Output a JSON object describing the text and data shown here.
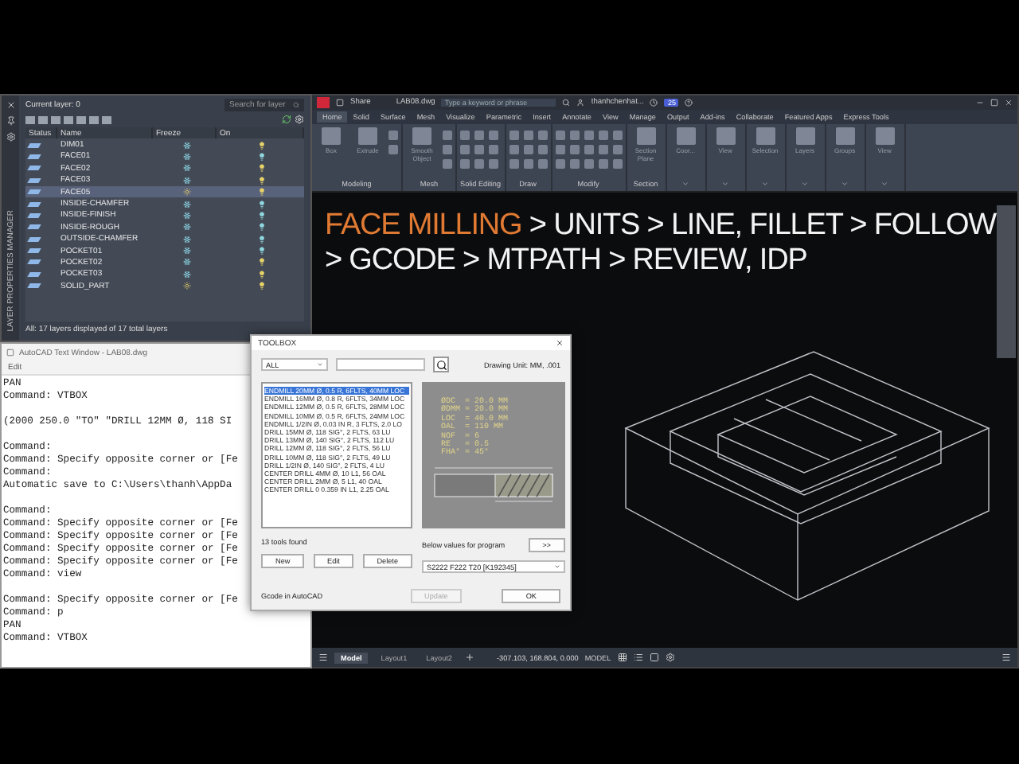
{
  "layer_manager": {
    "side_title": "LAYER PROPERTIES MANAGER",
    "current_layer": "Current layer: 0",
    "search": {
      "placeholder": "Search for layer"
    },
    "columns": [
      "Status",
      "Name",
      "Freeze",
      "On"
    ],
    "rows": [
      {
        "name": "DIM01",
        "frozen": true,
        "color": "#e8d36a",
        "selected": false
      },
      {
        "name": "FACE01",
        "frozen": true,
        "color": "#8fd8e0",
        "selected": false
      },
      {
        "name": "FACE02",
        "frozen": true,
        "color": "#e8d36a",
        "selected": false
      },
      {
        "name": "FACE03",
        "frozen": true,
        "color": "#e8d36a",
        "selected": false
      },
      {
        "name": "FACE05",
        "frozen": false,
        "color": "#e8d36a",
        "selected": true
      },
      {
        "name": "INSIDE-CHAMFER",
        "frozen": true,
        "color": "#8fd8e0",
        "selected": false
      },
      {
        "name": "INSIDE-FINISH",
        "frozen": true,
        "color": "#8fd8e0",
        "selected": false
      },
      {
        "name": "INSIDE-ROUGH",
        "frozen": true,
        "color": "#8fd8e0",
        "selected": false
      },
      {
        "name": "OUTSIDE-CHAMFER",
        "frozen": true,
        "color": "#8fd8e0",
        "selected": false
      },
      {
        "name": "POCKET01",
        "frozen": true,
        "color": "#8fd8e0",
        "selected": false
      },
      {
        "name": "POCKET02",
        "frozen": true,
        "color": "#e8d36a",
        "selected": false
      },
      {
        "name": "POCKET03",
        "frozen": true,
        "color": "#e8d36a",
        "selected": false
      },
      {
        "name": "SOLID_PART",
        "frozen": false,
        "color": "#e8d36a",
        "selected": false
      }
    ],
    "footer": "All: 17 layers displayed of 17 total layers"
  },
  "text_window": {
    "title": "AutoCAD Text Window - LAB08.dwg",
    "menu": [
      "Edit"
    ],
    "blocks": [
      [
        "PAN",
        "Command: VTBOX"
      ],
      [
        "(2000 250.0 \"TO\" \"DRILL 12MM Ø, 118 SI"
      ],
      [
        "Command:",
        "Command: Specify opposite corner or [Fe",
        "Command:",
        "Automatic save to C:\\Users\\thanh\\AppDa"
      ],
      [
        "Command:",
        "Command: Specify opposite corner or [Fe",
        "Command: Specify opposite corner or [Fe",
        "Command: Specify opposite corner or [Fe",
        "Command: Specify opposite corner or [Fe",
        "Command: view"
      ],
      [
        "Command: Specify opposite corner or [Fe",
        "Command: p",
        "PAN",
        "Command: VTBOX"
      ]
    ]
  },
  "toolbox": {
    "title": "TOOLBOX",
    "filter": "ALL",
    "unit": "Drawing Unit: MM, .001",
    "tools": [
      {
        "label": "ENDMILL 20MM Ø, 0.5 R, 6FLTS, 40MM LOC",
        "selected": true
      },
      {
        "label": "ENDMILL 16MM Ø, 0.8 R, 6FLTS, 34MM LOC",
        "selected": false
      },
      {
        "label": "ENDMILL 12MM Ø, 0.5 R, 6FLTS, 28MM LOC",
        "selected": false
      },
      {
        "label": "ENDMILL 10MM Ø, 0.5 R, 6FLTS, 24MM LOC",
        "selected": false
      },
      {
        "label": "ENDMILL 1/2IN Ø, 0.03 IN R, 3 FLTS, 2.0 LO",
        "selected": false
      },
      {
        "label": "DRILL 15MM Ø, 118 SIG°, 2 FLTS, 63 LU",
        "selected": false
      },
      {
        "label": "DRILL 13MM Ø, 140 SIG°, 2 FLTS, 112 LU",
        "selected": false
      },
      {
        "label": "DRILL 12MM Ø, 118 SIG°, 2 FLTS, 56 LU",
        "selected": false
      },
      {
        "label": "DRILL 10MM Ø, 118 SIG°, 2 FLTS, 49 LU",
        "selected": false
      },
      {
        "label": "DRILL 1/2IN Ø, 140 SIG°, 2 FLTS, 4 LU",
        "selected": false
      },
      {
        "label": "CENTER DRILL 4MM Ø, 10 L1, 56 OAL",
        "selected": false
      },
      {
        "label": "CENTER DRILL 2MM Ø, 5 L1, 40 OAL",
        "selected": false
      },
      {
        "label": "CENTER DRILL 0 0.359 IN L1, 2.25 OAL",
        "selected": false
      }
    ],
    "specs": [
      "ØDC  = 20.0 MM",
      "ØDMM = 20.0 MM",
      "LOC  = 40.0 MM",
      "OAL  = 110 MM",
      "NOF  = 6",
      "RE   = 0.5",
      "FHA° = 45°"
    ],
    "count": "13 tools found",
    "buttons": [
      "New",
      "Edit",
      "Delete"
    ],
    "program_label": "Below values for program",
    "arrow_button": ">>",
    "program_value": "S2222 F222 T20 [K192345]",
    "gcode_label": "Gcode in AutoCAD",
    "update": {
      "label": "Update",
      "disabled": true
    },
    "ok": "OK"
  },
  "autocad": {
    "file": "LAB08.dwg",
    "share": "Share",
    "search": {
      "placeholder": "Type a keyword or phrase"
    },
    "user": "thanhchenhat...",
    "badge": "25",
    "tabs": [
      {
        "label": "Home",
        "selected": true
      },
      {
        "label": "Solid",
        "selected": false
      },
      {
        "label": "Surface",
        "selected": false
      },
      {
        "label": "Mesh",
        "selected": false
      },
      {
        "label": "Visualize",
        "selected": false
      },
      {
        "label": "Parametric",
        "selected": false
      },
      {
        "label": "Insert",
        "selected": false
      },
      {
        "label": "Annotate",
        "selected": false
      },
      {
        "label": "View",
        "selected": false
      },
      {
        "label": "Manage",
        "selected": false
      },
      {
        "label": "Output",
        "selected": false
      },
      {
        "label": "Add-ins",
        "selected": false
      },
      {
        "label": "Collaborate",
        "selected": false
      },
      {
        "label": "Featured Apps",
        "selected": false
      },
      {
        "label": "Express Tools",
        "selected": false
      }
    ],
    "panels": [
      {
        "label": "Modeling",
        "tools": [
          "Box",
          "Extrude"
        ]
      },
      {
        "label": "Mesh",
        "tools": [
          "Smooth Object"
        ]
      },
      {
        "label": "Solid Editing"
      },
      {
        "label": "Draw"
      },
      {
        "label": "Modify"
      },
      {
        "label": "Section",
        "tools": [
          "Section Plane"
        ]
      },
      {
        "tools": [
          "Coor..."
        ]
      },
      {
        "tools": [
          "View"
        ]
      },
      {
        "tools": [
          "Selection"
        ]
      },
      {
        "tools": [
          "Layers"
        ]
      },
      {
        "tools": [
          "Groups"
        ]
      },
      {
        "tools": [
          "View"
        ]
      }
    ],
    "headline": {
      "highlight": "FACE MILLING",
      "lines": [
        " > UNITS > LINE, FILLET > FOLLOW",
        "> GCODE > MTPATH > REVIEW, IDP"
      ]
    },
    "layout_tabs": [
      {
        "label": "Model",
        "selected": true
      },
      {
        "label": "Layout1",
        "selected": false
      },
      {
        "label": "Layout2",
        "selected": false
      }
    ],
    "coordinates": "-307.103, 168.804, 0.000",
    "space": "MODEL"
  }
}
